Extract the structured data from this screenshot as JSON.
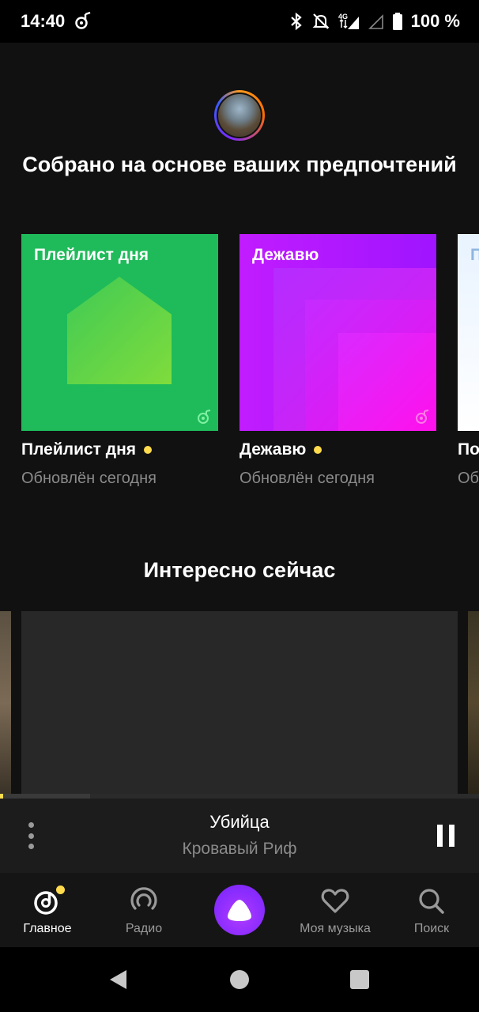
{
  "status_bar": {
    "time": "14:40",
    "battery": "100 %",
    "network": "4G",
    "icons": [
      "music-note-icon",
      "bluetooth-icon",
      "mute-icon",
      "signal-4g-icon",
      "signal-empty-icon",
      "battery-icon"
    ]
  },
  "recommendations": {
    "title": "Собрано на основе ваших предпочтений",
    "cards": [
      {
        "cover_label": "Плейлист дня",
        "name": "Плейлист дня",
        "subtitle": "Обновлён сегодня",
        "new_indicator": true
      },
      {
        "cover_label": "Дежавю",
        "name": "Дежавю",
        "subtitle": "Обновлён сегодня",
        "new_indicator": true
      },
      {
        "cover_label": "П н",
        "name": "По",
        "subtitle": "Об"
      }
    ]
  },
  "interesting": {
    "title": "Интересно сейчас"
  },
  "player": {
    "track_title": "Убийца",
    "track_artist": "Кровавый Риф",
    "state": "playing"
  },
  "bottom_nav": {
    "items": [
      {
        "label": "Главное",
        "icon": "home-music-icon",
        "active": true
      },
      {
        "label": "Радио",
        "icon": "radio-icon",
        "active": false
      },
      {
        "label": "",
        "icon": "alice-icon",
        "active": false
      },
      {
        "label": "Моя музыка",
        "icon": "heart-icon",
        "active": false
      },
      {
        "label": "Поиск",
        "icon": "search-icon",
        "active": false
      }
    ]
  },
  "colors": {
    "accent_yellow": "#ffdb4d",
    "background": "#111111",
    "alice_purple": "#8a2cff",
    "green_cover": "#1fbb5a",
    "purple_cover": "#c11cff"
  }
}
